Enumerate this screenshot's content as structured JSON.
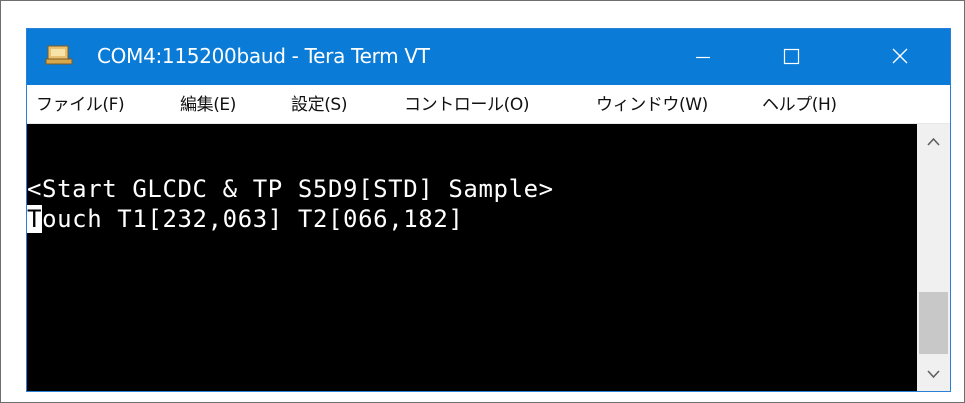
{
  "window": {
    "title": "COM4:115200baud - Tera Term VT",
    "icon": "tera-term-app-icon",
    "controls": {
      "minimize_icon": "minimize-icon",
      "maximize_icon": "maximize-icon",
      "close_icon": "close-icon"
    },
    "titlebar_color": "#0a7cd8"
  },
  "menu": {
    "items": [
      {
        "label": "ファイル(F)"
      },
      {
        "label": "編集(E)"
      },
      {
        "label": "設定(S)"
      },
      {
        "label": "コントロール(O)"
      },
      {
        "label": "ウィンドウ(W)"
      },
      {
        "label": "ヘルプ(H)"
      }
    ]
  },
  "terminal": {
    "line1": "<Start GLCDC & TP S5D9[STD] Sample>",
    "line2_cursor_char": "T",
    "line2_rest": "ouch T1[232,063] T2[066,182]",
    "background": "#000000",
    "foreground": "#ffffff"
  },
  "scrollbar": {
    "up_icon": "chevron-up-icon",
    "down_icon": "chevron-down-icon"
  }
}
